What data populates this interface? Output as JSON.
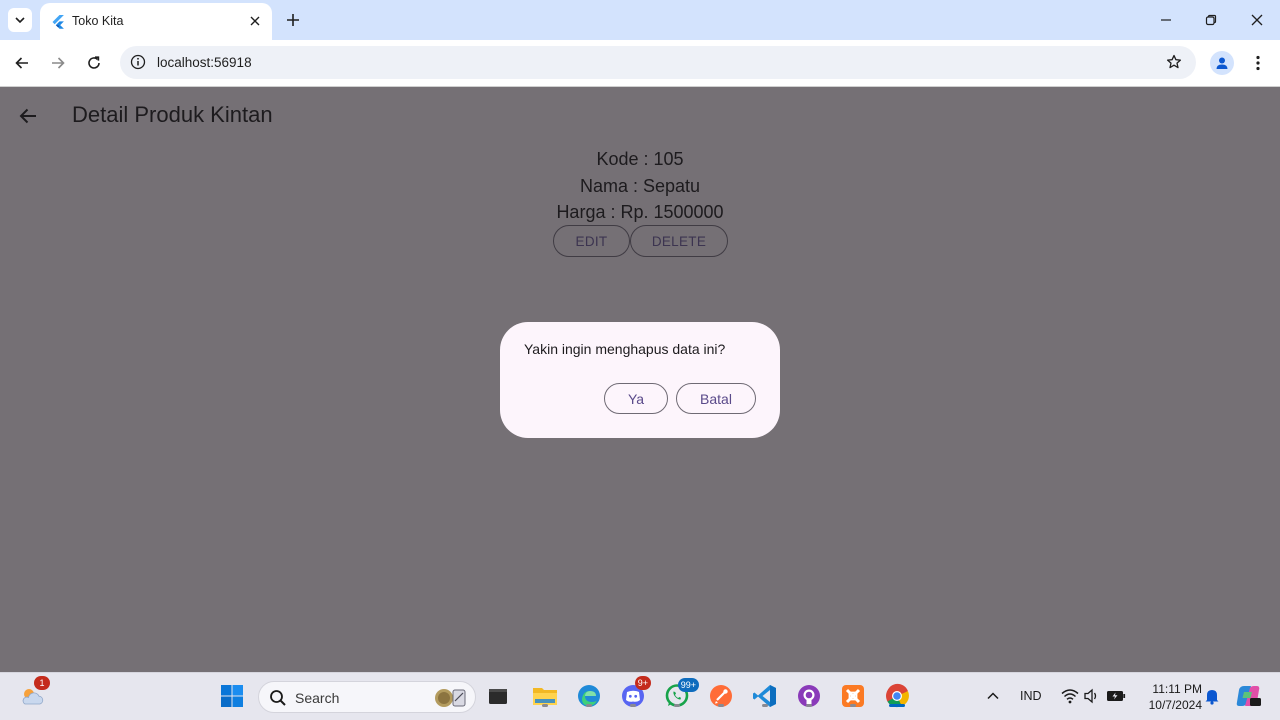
{
  "browser": {
    "tab_title": "Toko Kita",
    "url": "localhost:56918"
  },
  "app": {
    "title": "Detail Produk Kintan",
    "detail": {
      "kode": "Kode : 105",
      "nama": "Nama : Sepatu",
      "harga": "Harga : Rp. 1500000"
    },
    "edit_label": "EDIT",
    "delete_label": "DELETE"
  },
  "dialog": {
    "message": "Yakin ingin menghapus data ini?",
    "confirm_label": "Ya",
    "cancel_label": "Batal"
  },
  "taskbar": {
    "weather_badge": "1",
    "search_placeholder": "Search",
    "discord_badge": "9+",
    "whatsapp_badge": "99+",
    "language": "IND",
    "time": "11:11 PM",
    "date": "10/7/2024",
    "apps": [
      "widgets-weather",
      "start",
      "search",
      "task-view",
      "file-explorer",
      "edge",
      "discord",
      "whatsapp",
      "postman",
      "vscode",
      "github-desktop",
      "xampp",
      "chrome"
    ]
  },
  "colors": {
    "scrim": "#757075",
    "dialog_bg": "#fdf5fc",
    "tabstrip": "#d3e3fd",
    "accent": "#5a4a8a"
  }
}
